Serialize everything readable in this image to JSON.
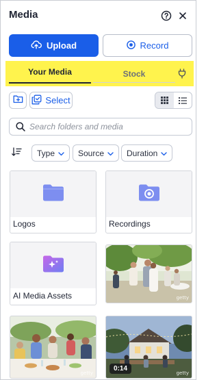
{
  "header": {
    "title": "Media",
    "help_icon": "help-circle-icon",
    "close_icon": "close-icon"
  },
  "actions": {
    "upload_label": "Upload",
    "record_label": "Record"
  },
  "tabs": {
    "your_media": "Your Media",
    "stock": "Stock",
    "plugin_icon": "plug-icon"
  },
  "toolbar": {
    "select_label": "Select"
  },
  "search": {
    "placeholder": "Search folders and media"
  },
  "filters": {
    "type": "Type",
    "source": "Source",
    "duration": "Duration"
  },
  "items": [
    {
      "name": "Logos",
      "kind": "folder"
    },
    {
      "name": "Recordings",
      "kind": "folder"
    },
    {
      "name": "AI Media Assets",
      "kind": "folder"
    },
    {
      "kind": "image",
      "watermark": "getty"
    },
    {
      "kind": "image",
      "watermark": "getty"
    },
    {
      "kind": "video",
      "duration": "0:14",
      "watermark": "getty"
    }
  ],
  "colors": {
    "accent": "#1a5ee8",
    "highlight": "#fff34d",
    "folder": "#7d8ef0"
  }
}
